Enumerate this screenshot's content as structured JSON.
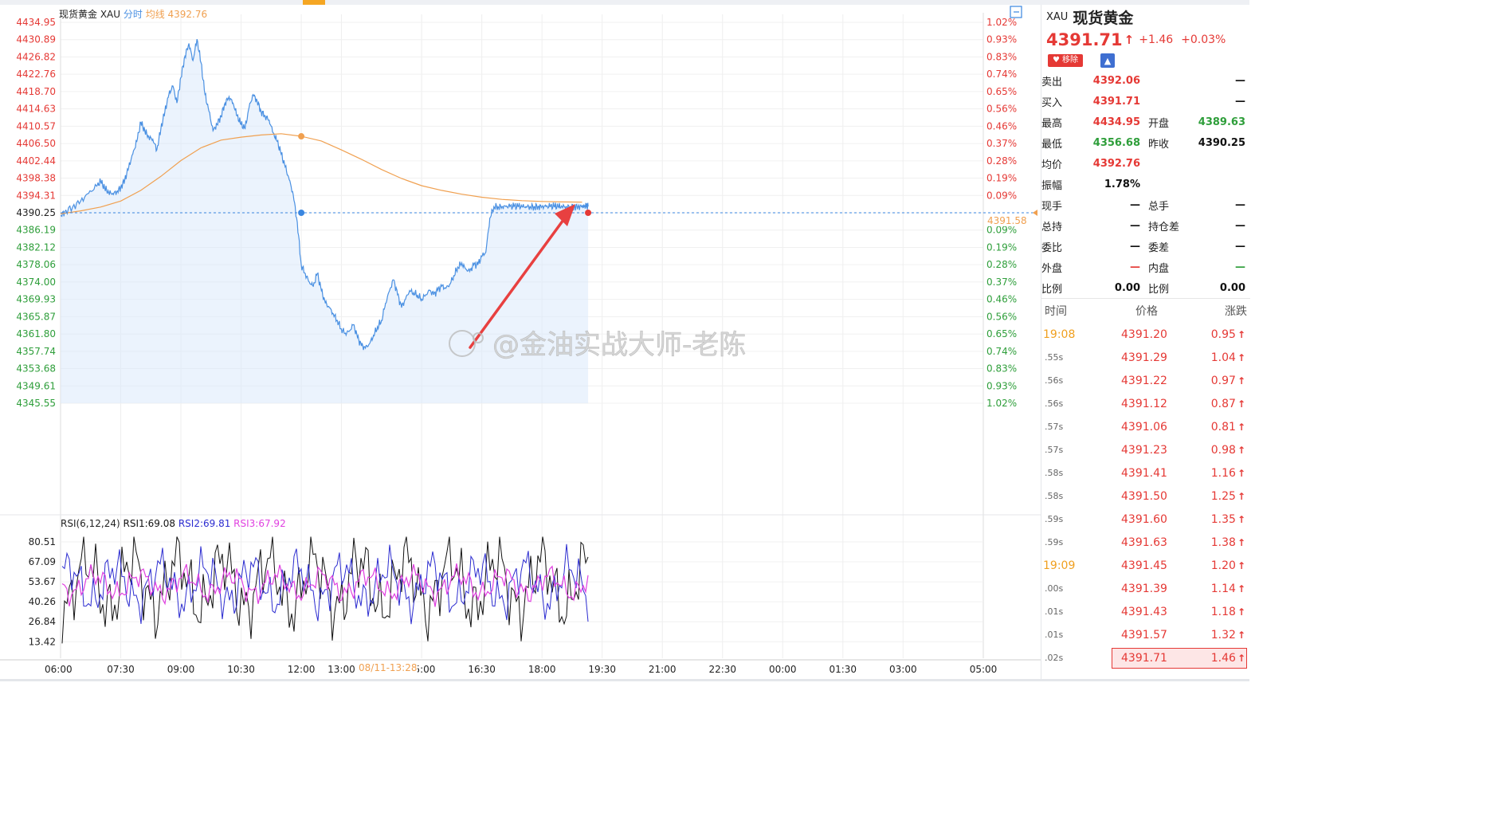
{
  "header": {
    "name": "现货黄金",
    "code": "XAU",
    "mode": "分时",
    "avg_label": "均线",
    "avg_value": "4392.76",
    "current_price_label": "4391.58"
  },
  "watermark": "@金油实战大师-老陈",
  "chart_data": [
    {
      "type": "line",
      "title": "现货黄金 XAU 分时",
      "y_ticks": [
        "4434.95",
        "4430.89",
        "4426.82",
        "4422.76",
        "4418.70",
        "4414.63",
        "4410.57",
        "4406.50",
        "4402.44",
        "4398.38",
        "4394.31",
        "4390.25",
        "4386.19",
        "4382.12",
        "4378.06",
        "4374.00",
        "4369.93",
        "4365.87",
        "4361.80",
        "4357.74",
        "4353.68",
        "4349.61",
        "4345.55"
      ],
      "pct_ticks": [
        "1.02%",
        "0.93%",
        "0.83%",
        "0.74%",
        "0.65%",
        "0.56%",
        "0.46%",
        "0.37%",
        "0.28%",
        "0.19%",
        "0.09%",
        "",
        "0.09%",
        "0.19%",
        "0.28%",
        "0.37%",
        "0.46%",
        "0.56%",
        "0.65%",
        "0.74%",
        "0.83%",
        "0.93%",
        "1.02%"
      ],
      "ylim": [
        4345.55,
        4434.95
      ],
      "base": 4390.25,
      "x_ticks": [
        "06:00",
        "07:30",
        "09:00",
        "10:30",
        "12:00",
        "13:00",
        "15:00",
        "16:30",
        "18:00",
        "19:30",
        "21:00",
        "22:30",
        "00:00",
        "01:30",
        "03:00",
        "05:00"
      ],
      "crosshair_time": "08/11-13:28",
      "series": [
        {
          "name": "分时",
          "color": "#4a90e2",
          "x_hours": [
            0,
            0.1,
            0.3,
            0.5,
            0.7,
            0.9,
            1.0,
            1.1,
            1.2,
            1.3,
            1.4,
            1.5,
            1.6,
            1.7,
            1.8,
            1.9,
            2.0,
            2.1,
            2.2,
            2.3,
            2.4,
            2.5,
            2.6,
            2.7,
            2.8,
            2.9,
            3.0,
            3.1,
            3.2,
            3.3,
            3.4,
            3.5,
            3.6,
            3.7,
            3.8,
            3.9,
            4.0,
            4.1,
            4.2,
            4.3,
            4.4,
            4.5,
            4.6,
            4.7,
            4.8,
            4.9,
            5.0,
            5.1,
            5.2,
            5.3,
            5.4,
            5.5,
            5.6,
            5.7,
            5.8,
            5.9,
            6.0,
            6.1,
            6.2,
            6.3,
            6.4,
            6.5,
            6.6,
            6.7,
            6.8,
            6.9,
            7.0,
            7.1,
            7.2,
            7.3,
            7.4,
            7.5,
            7.6,
            7.7,
            7.8,
            7.9,
            8.0,
            8.1,
            8.2,
            8.3,
            8.4,
            8.5,
            8.6,
            8.7,
            8.8,
            8.9,
            9.0,
            9.1,
            9.2,
            9.3,
            9.4,
            9.5,
            9.6,
            9.7,
            9.8,
            9.9,
            10.0,
            10.1,
            10.2,
            10.3,
            10.4,
            10.5,
            10.6,
            10.7,
            10.8,
            10.9,
            11.0,
            11.1,
            11.2,
            11.3,
            11.4,
            11.5,
            11.6,
            11.7,
            11.8,
            11.9,
            12.0,
            12.1,
            12.2,
            12.3,
            12.4,
            12.5,
            12.6,
            12.7,
            12.8,
            12.9,
            13.0,
            13.05,
            13.1,
            13.15
          ],
          "values": [
            4389.5,
            4390.5,
            4391.6,
            4393.0,
            4394.8,
            4396.5,
            4397.6,
            4396.0,
            4395.0,
            4394.8,
            4395.2,
            4396.2,
            4398.0,
            4401.0,
            4404.0,
            4407.0,
            4411.5,
            4409.5,
            4408.0,
            4407.5,
            4405.0,
            4410.0,
            4414.0,
            4418.0,
            4420.0,
            4416.0,
            4422.0,
            4427.0,
            4430.0,
            4426.0,
            4431.0,
            4425.5,
            4418.0,
            4414.0,
            4409.5,
            4411.0,
            4413.0,
            4416.0,
            4417.5,
            4416.0,
            4413.0,
            4411.0,
            4410.0,
            4415.0,
            4418.0,
            4416.5,
            4414.0,
            4413.0,
            4412.0,
            4409.0,
            4407.0,
            4404.0,
            4401.0,
            4398.0,
            4394.5,
            4388.0,
            4378.0,
            4376.0,
            4374.0,
            4373.0,
            4376.0,
            4372.0,
            4369.0,
            4368.0,
            4366.5,
            4365.0,
            4363.0,
            4362.0,
            4362.5,
            4364.0,
            4361.0,
            4359.0,
            4358.5,
            4359.5,
            4361.5,
            4363.5,
            4365.0,
            4369.0,
            4372.0,
            4374.5,
            4371.0,
            4368.0,
            4370.0,
            4372.0,
            4371.5,
            4371.0,
            4370.0,
            4371.0,
            4372.0,
            4371.0,
            4372.0,
            4373.0,
            4372.5,
            4373.5,
            4375.5,
            4377.5,
            4378.5,
            4377.0,
            4376.5,
            4378.0,
            4378.0,
            4380.0,
            4381.0,
            4389.0,
            4391.71,
            4391.71,
            4391.71,
            4391.71,
            4391.71,
            4391.71,
            4391.71,
            4391.71,
            4391.71,
            4391.71,
            4391.71,
            4391.71,
            4391.71,
            4391.71,
            4391.71,
            4391.71,
            4391.71,
            4391.71,
            4391.71,
            4391.71,
            4391.71,
            4391.71,
            4391.71,
            4391.71,
            4391.71,
            4391.71,
            4391.71,
            4391.71
          ]
        },
        {
          "name": "均线",
          "color": "#f0a050",
          "x_hours": [
            0,
            0.5,
            1.0,
            1.5,
            2.0,
            2.5,
            3.0,
            3.5,
            4.0,
            4.5,
            5.0,
            5.5,
            6.0,
            6.5,
            7.0,
            7.5,
            8.0,
            8.5,
            9.0,
            9.5,
            10.0,
            10.5,
            11.0,
            11.5,
            12.0,
            12.5,
            13.0
          ],
          "values": [
            4390.0,
            4390.7,
            4391.6,
            4393.0,
            4395.5,
            4398.8,
            4402.5,
            4405.5,
            4407.3,
            4408.0,
            4408.5,
            4408.8,
            4408.2,
            4407.1,
            4405.0,
            4402.8,
            4400.4,
            4398.3,
            4396.6,
            4395.5,
            4394.6,
            4393.9,
            4393.4,
            4393.1,
            4392.9,
            4392.8,
            4392.76
          ]
        }
      ]
    },
    {
      "type": "line",
      "title": "RSI(6,12,24)",
      "legend": [
        {
          "label": "RSI(6,12,24)",
          "value": "",
          "color": "#222222"
        },
        {
          "label": "RSI1:",
          "value": "69.08",
          "color": "#111111"
        },
        {
          "label": "RSI2:",
          "value": "69.81",
          "color": "#2b2bd0"
        },
        {
          "label": "RSI3:",
          "value": "67.92",
          "color": "#e040e0"
        }
      ],
      "y_ticks": [
        "80.51",
        "67.09",
        "53.67",
        "40.26",
        "26.84",
        "13.42"
      ],
      "ylim": [
        5,
        88
      ]
    }
  ],
  "sidebar": {
    "code": "XAU",
    "name": "现货黄金",
    "price": "4391.71",
    "change": "+1.46",
    "change_pct": "+0.03%",
    "remove_label": "移除",
    "rows": [
      {
        "l1": "卖出",
        "v1": "4392.06",
        "c1": "red",
        "l2": "",
        "v2": "—",
        "c2": "dark"
      },
      {
        "l1": "买入",
        "v1": "4391.71",
        "c1": "red",
        "l2": "",
        "v2": "—",
        "c2": "dark"
      },
      {
        "l1": "最高",
        "v1": "4434.95",
        "c1": "red",
        "l2": "开盘",
        "v2": "4389.63",
        "c2": "green"
      },
      {
        "l1": "最低",
        "v1": "4356.68",
        "c1": "green",
        "l2": "昨收",
        "v2": "4390.25",
        "c2": "dark"
      },
      {
        "l1": "均价",
        "v1": "4392.76",
        "c1": "red",
        "l2": "",
        "v2": "",
        "c2": "dark"
      },
      {
        "l1": "振幅",
        "v1": "1.78%",
        "c1": "dark",
        "l2": "",
        "v2": "",
        "c2": "dark"
      },
      {
        "l1": "现手",
        "v1": "—",
        "c1": "dark",
        "l2": "总手",
        "v2": "—",
        "c2": "dark"
      },
      {
        "l1": "总持",
        "v1": "—",
        "c1": "dark",
        "l2": "持仓差",
        "v2": "—",
        "c2": "dark"
      },
      {
        "l1": "委比",
        "v1": "—",
        "c1": "dark",
        "l2": "委差",
        "v2": "—",
        "c2": "dark"
      },
      {
        "l1": "外盘",
        "v1": "—",
        "c1": "red",
        "l2": "内盘",
        "v2": "—",
        "c2": "green"
      },
      {
        "l1": "比例",
        "v1": "0.00",
        "c1": "dark",
        "l2": "比例",
        "v2": "0.00",
        "c2": "dark"
      }
    ],
    "ticks_header": {
      "time": "时间",
      "price": "价格",
      "change": "涨跌"
    },
    "ticks": [
      {
        "time": "19:08",
        "major": true,
        "price": "4391.20",
        "change": "0.95"
      },
      {
        "time": ".55s",
        "major": false,
        "price": "4391.29",
        "change": "1.04"
      },
      {
        "time": ".56s",
        "major": false,
        "price": "4391.22",
        "change": "0.97"
      },
      {
        "time": ".56s",
        "major": false,
        "price": "4391.12",
        "change": "0.87"
      },
      {
        "time": ".57s",
        "major": false,
        "price": "4391.06",
        "change": "0.81"
      },
      {
        "time": ".57s",
        "major": false,
        "price": "4391.23",
        "change": "0.98"
      },
      {
        "time": ".58s",
        "major": false,
        "price": "4391.41",
        "change": "1.16"
      },
      {
        "time": ".58s",
        "major": false,
        "price": "4391.50",
        "change": "1.25"
      },
      {
        "time": ".59s",
        "major": false,
        "price": "4391.60",
        "change": "1.35"
      },
      {
        "time": ".59s",
        "major": false,
        "price": "4391.63",
        "change": "1.38"
      },
      {
        "time": "19:09",
        "major": true,
        "price": "4391.45",
        "change": "1.20"
      },
      {
        "time": ".00s",
        "major": false,
        "price": "4391.39",
        "change": "1.14"
      },
      {
        "time": ".01s",
        "major": false,
        "price": "4391.43",
        "change": "1.18"
      },
      {
        "time": ".01s",
        "major": false,
        "price": "4391.57",
        "change": "1.32"
      },
      {
        "time": ".02s",
        "major": false,
        "price": "4391.71",
        "change": "1.46",
        "highlight": true
      }
    ]
  }
}
